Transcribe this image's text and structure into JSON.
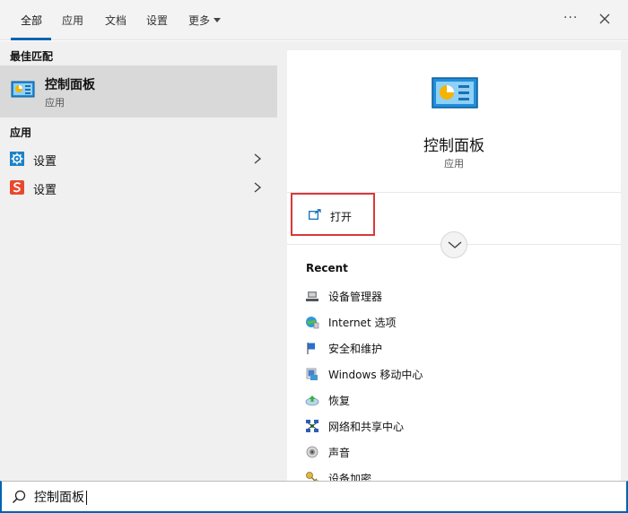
{
  "tabs": [
    {
      "label": "全部",
      "active": true
    },
    {
      "label": "应用",
      "active": false
    },
    {
      "label": "文档",
      "active": false
    },
    {
      "label": "设置",
      "active": false
    },
    {
      "label": "更多",
      "active": false
    }
  ],
  "topbar": {
    "more_icon": "ellipsis-icon",
    "close_icon": "close-icon"
  },
  "left": {
    "best_match_heading": "最佳匹配",
    "best_match": {
      "title": "控制面板",
      "subtitle": "应用",
      "icon": "control-panel-icon"
    },
    "apps_heading": "应用",
    "apps": [
      {
        "label": "设置",
        "icon": "settings-gear-icon"
      },
      {
        "label": "设置",
        "icon": "sogou-s-icon"
      }
    ]
  },
  "detail": {
    "title": "控制面板",
    "subtitle": "应用",
    "open_label": "打开",
    "recent_heading": "Recent",
    "recent": [
      {
        "label": "设备管理器",
        "icon": "device-manager-icon"
      },
      {
        "label": "Internet 选项",
        "icon": "internet-options-icon"
      },
      {
        "label": "安全和维护",
        "icon": "security-flag-icon"
      },
      {
        "label": "Windows 移动中心",
        "icon": "mobility-center-icon"
      },
      {
        "label": "恢复",
        "icon": "recovery-icon"
      },
      {
        "label": "网络和共享中心",
        "icon": "network-icon"
      },
      {
        "label": "声音",
        "icon": "sound-icon"
      },
      {
        "label": "设备加密",
        "icon": "encryption-key-icon"
      }
    ]
  },
  "search": {
    "value": "控制面板"
  },
  "colors": {
    "accent": "#0063b1",
    "highlight_box": "#d9383a",
    "selected_row": "#d9d9d9",
    "pane_bg": "#f0f0f0"
  }
}
